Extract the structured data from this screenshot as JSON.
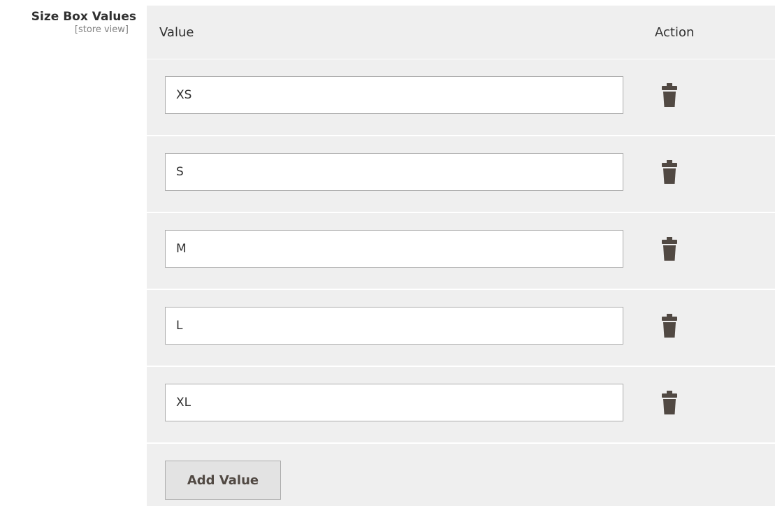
{
  "field": {
    "label": "Size Box Values",
    "scope": "[store view]"
  },
  "grid": {
    "headers": {
      "value": "Value",
      "action": "Action"
    },
    "rows": [
      {
        "value": "XS"
      },
      {
        "value": "S"
      },
      {
        "value": "M"
      },
      {
        "value": "L"
      },
      {
        "value": "XL"
      }
    ]
  },
  "actions": {
    "add_label": "Add Value"
  },
  "icons": {
    "delete": "trash-icon"
  },
  "colors": {
    "grid_background": "#efefef",
    "icon": "#514943",
    "text": "#303030",
    "muted": "#808080"
  }
}
